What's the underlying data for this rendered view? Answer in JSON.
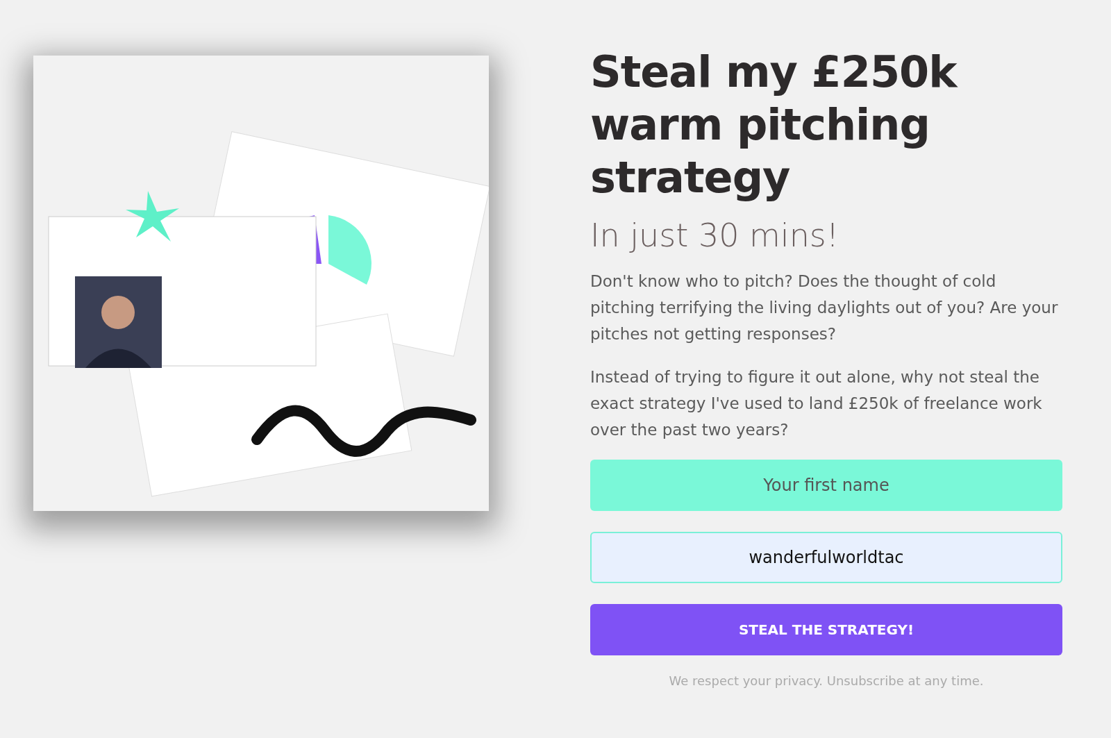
{
  "headline": "Steal my £250k warm pitching strategy",
  "subheadline": "In just 30 mins!",
  "paragraphs": [
    "Don't know who to pitch? Does the thought of cold pitching terrifying the living daylights out of you? Are your pitches not getting responses?",
    "Instead of trying to figure it out alone, why not steal the exact strategy I've used to land £250k of freelance work over the past two years?"
  ],
  "form": {
    "fields": [
      {
        "kind": "plain",
        "placeholder": "Your first name"
      },
      {
        "kind": "autofilled",
        "value": "wanderfulworldtac"
      }
    ],
    "submit_button": "STEAL THE STRATEGY!",
    "privacy_note": "We respect your privacy. Unsubscribe at any time."
  }
}
